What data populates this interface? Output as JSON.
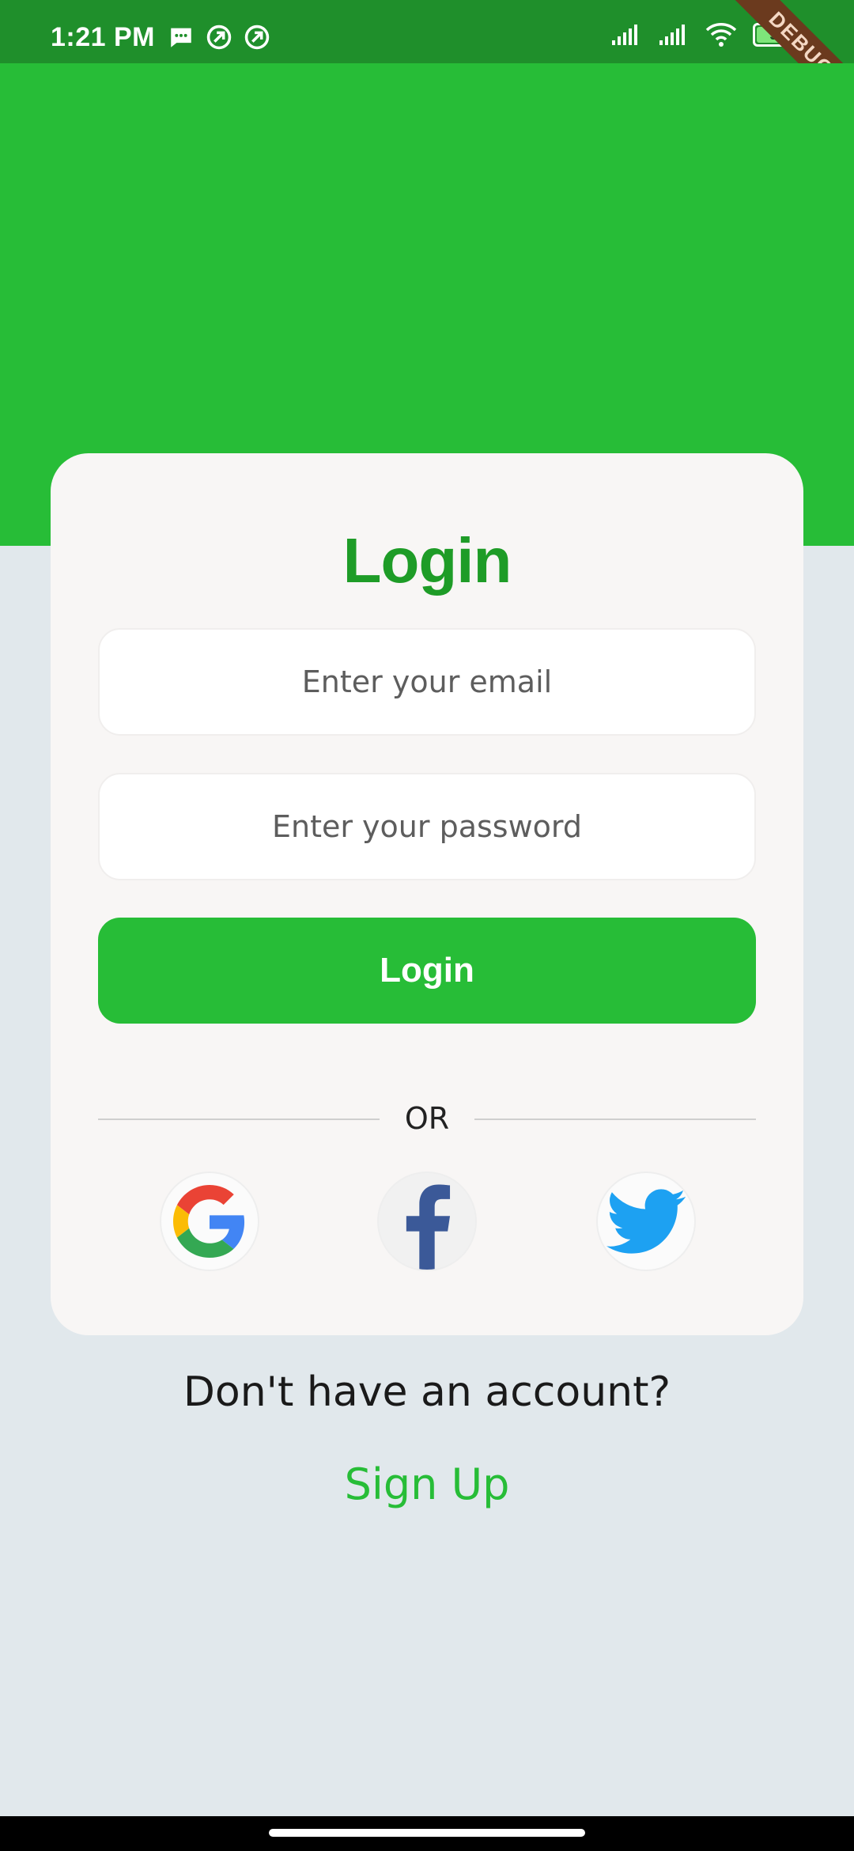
{
  "status_bar": {
    "time": "1:21 PM",
    "battery": "95",
    "battery_level": 0.95
  },
  "debug_banner": "DEBUG",
  "card": {
    "title": "Login",
    "email_placeholder": "Enter your email",
    "password_placeholder": "Enter your password",
    "login_button": "Login",
    "divider_text": "OR"
  },
  "social": {
    "google_icon": "google-logo",
    "facebook_icon": "facebook-logo",
    "twitter_icon": "twitter-bird"
  },
  "footer": {
    "prompt": "Don't have an account?",
    "signup_link": "Sign Up"
  },
  "colors": {
    "primary_green": "#27bd37",
    "status_green": "#1f8f2b",
    "title_green": "#1e9c27",
    "background": "#e1e8ec",
    "card": "#f8f6f5"
  }
}
